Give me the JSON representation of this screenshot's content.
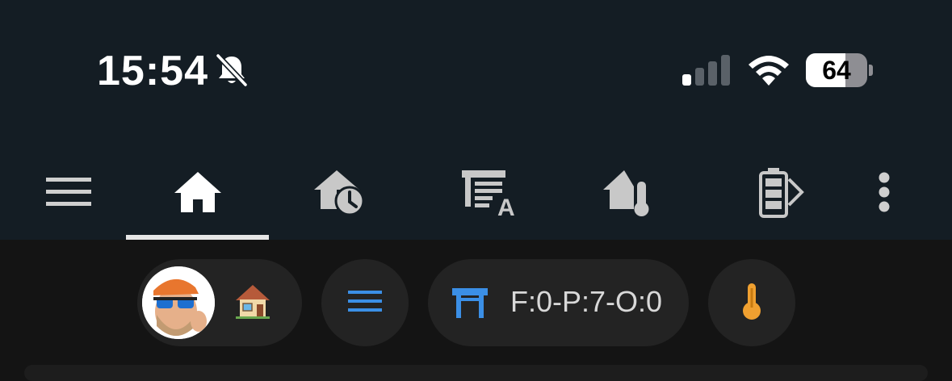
{
  "status_bar": {
    "time": "15:54",
    "silent_icon": "bell-slash-icon",
    "signal_bars": 1,
    "wifi_icon": "wifi-icon",
    "battery_percent": "64",
    "battery_level": 0.64
  },
  "toolbar": {
    "tabs": [
      {
        "icon": "menu-icon"
      },
      {
        "icon": "home-icon",
        "selected": true
      },
      {
        "icon": "home-history-icon"
      },
      {
        "icon": "garage-auto-icon"
      },
      {
        "icon": "home-thermometer-icon"
      },
      {
        "icon": "battery-export-icon"
      },
      {
        "icon": "more-vertical-icon"
      }
    ]
  },
  "chips": {
    "person_chip": {
      "avatar": "memoji-avatar",
      "icon": "house-emoji-icon"
    },
    "menu_chip": {
      "icon": "menu-icon"
    },
    "garage_chip": {
      "icon": "garage-icon",
      "label": "F:0-P:7-O:0"
    },
    "temp_chip": {
      "icon": "thermometer-icon"
    }
  },
  "colors": {
    "top_bg": "#141d24",
    "body_bg": "#141414",
    "chip_bg": "#232323",
    "icon_gray": "#c8c8c8",
    "accent_blue": "#3b8fe6",
    "accent_orange": "#f0a030"
  }
}
